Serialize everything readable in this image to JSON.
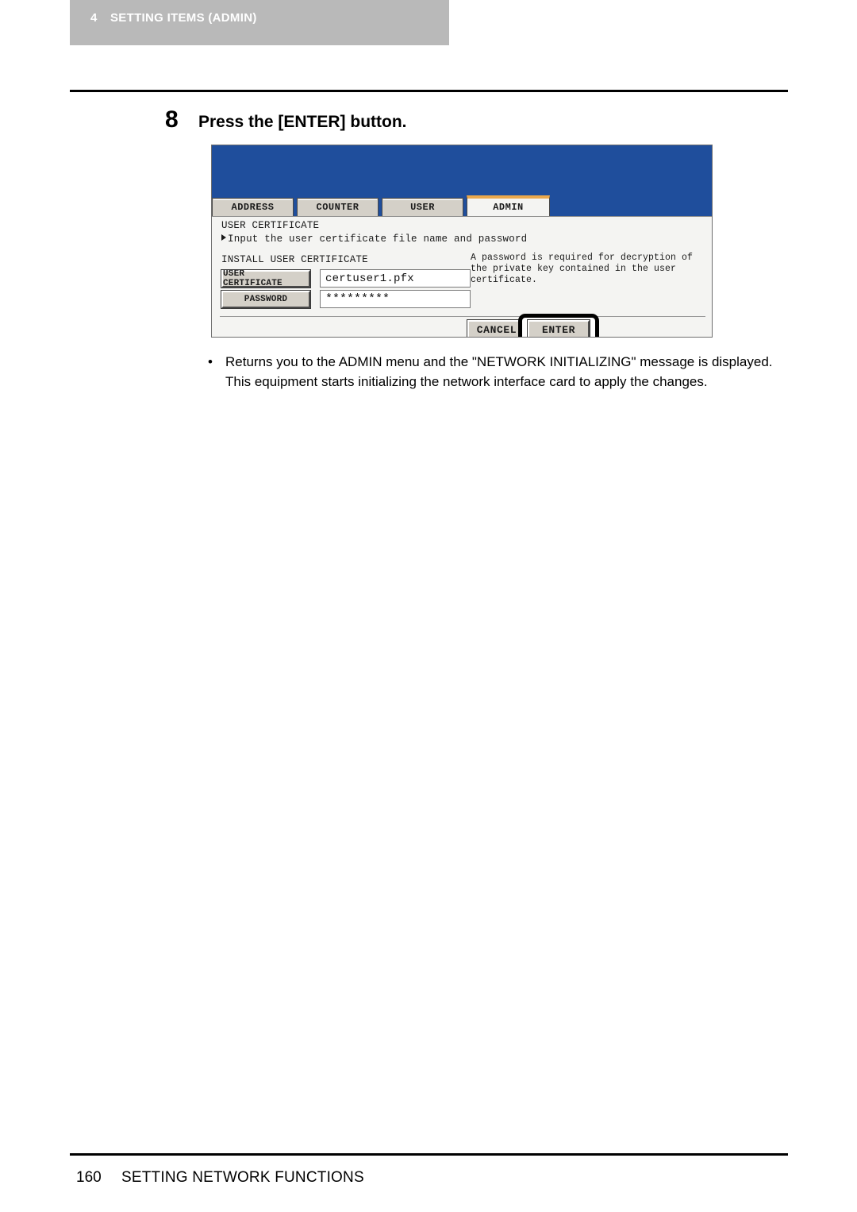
{
  "header": {
    "chapter_number": "4",
    "chapter_title": "SETTING ITEMS (ADMIN)",
    "bar_color": "#b9b9b9"
  },
  "step": {
    "number": "8",
    "text": "Press the [ENTER] button."
  },
  "device_screen": {
    "header_color": "#1f4e9c",
    "active_tab_accent": "#eaa84c",
    "tabs": [
      {
        "label": "ADDRESS",
        "active": false
      },
      {
        "label": "COUNTER",
        "active": false
      },
      {
        "label": "USER",
        "active": false
      },
      {
        "label": "ADMIN",
        "active": true
      }
    ],
    "screen_title": "USER CERTIFICATE",
    "instruction": "Input the user certificate file name and password",
    "section_label": "INSTALL USER CERTIFICATE",
    "help_text": "A password is required for decryption of the private key contained in the user certificate.",
    "fields": [
      {
        "button_label": "USER CERTIFICATE",
        "value": "certuser1.pfx"
      },
      {
        "button_label": "PASSWORD",
        "value": "*********"
      }
    ],
    "actions": {
      "cancel_label": "CANCEL",
      "enter_label": "ENTER"
    }
  },
  "note": {
    "bullet": "•",
    "text": "Returns you to the ADMIN menu and the \"NETWORK INITIALIZING\" message is displayed.  This equipment starts initializing the network interface card to apply the changes."
  },
  "footer": {
    "page_number": "160",
    "section_title": "SETTING NETWORK FUNCTIONS"
  }
}
